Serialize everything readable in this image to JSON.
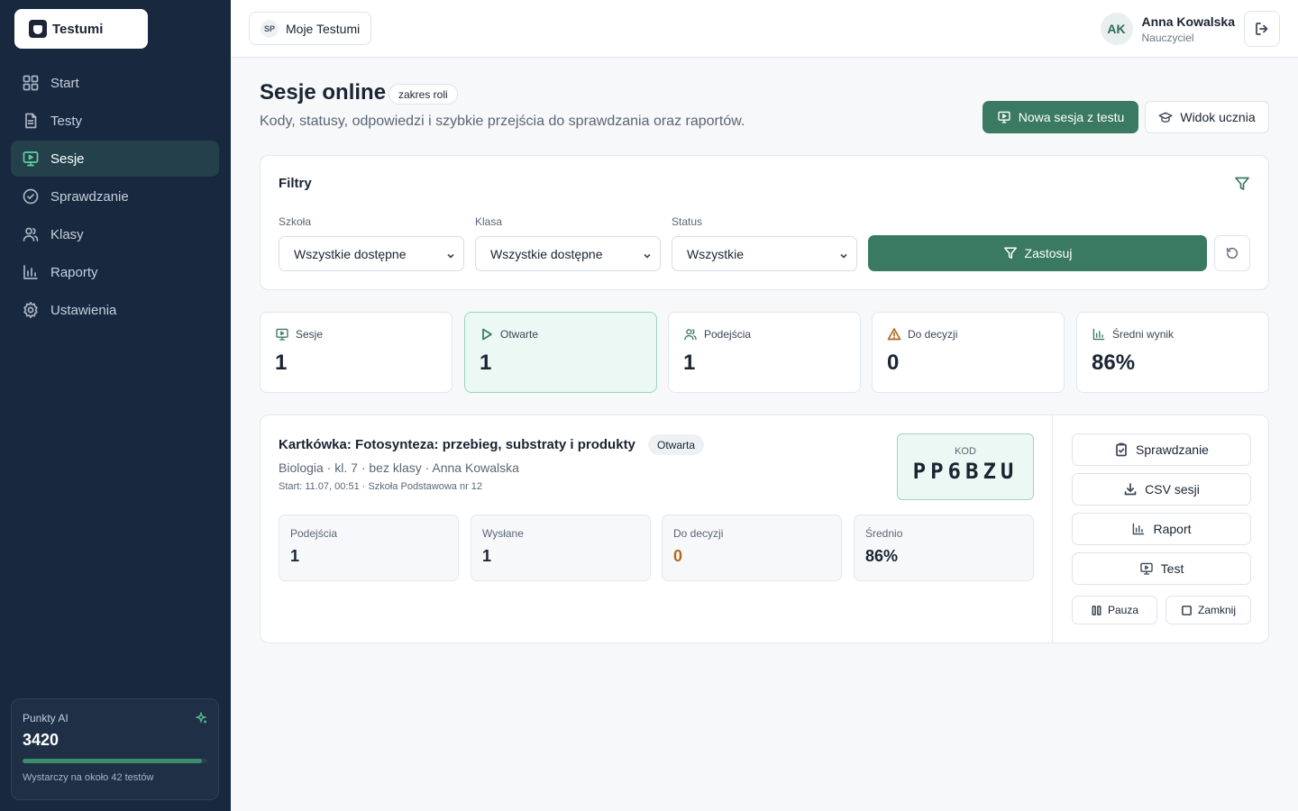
{
  "app": {
    "name": "Testumi"
  },
  "sidebar": {
    "items": [
      {
        "label": "Start",
        "icon": "grid-icon"
      },
      {
        "label": "Testy",
        "icon": "document-icon"
      },
      {
        "label": "Sesje",
        "icon": "monitor-icon",
        "active": true
      },
      {
        "label": "Sprawdzanie",
        "icon": "check-circle-icon"
      },
      {
        "label": "Klasy",
        "icon": "users-icon"
      },
      {
        "label": "Raporty",
        "icon": "bar-chart-icon"
      },
      {
        "label": "Ustawienia",
        "icon": "gear-icon"
      }
    ],
    "ai": {
      "label": "Punkty AI",
      "value": "3420",
      "progress": 0.97,
      "note": "Wystarczy na około 42 testów"
    }
  },
  "topbar": {
    "workspace_badge": "SP",
    "workspace_label": "Moje Testumi",
    "user": {
      "initials": "AK",
      "name": "Anna Kowalska",
      "role": "Nauczyciel"
    }
  },
  "page": {
    "title": "Sesje online",
    "scope_badge": "zakres roli",
    "subtitle": "Kody, statusy, odpowiedzi i szybkie przejścia do sprawdzania oraz raportów.",
    "new_session_label": "Nowa sesja z testu",
    "student_view_label": "Widok ucznia"
  },
  "filters": {
    "title": "Filtry",
    "school": {
      "label": "Szkoła",
      "value": "Wszystkie dostępne"
    },
    "class": {
      "label": "Klasa",
      "value": "Wszystkie dostępne"
    },
    "status": {
      "label": "Status",
      "value": "Wszystkie"
    },
    "apply_label": "Zastosuj"
  },
  "stats": [
    {
      "label": "Sesje",
      "value": "1"
    },
    {
      "label": "Otwarte",
      "value": "1"
    },
    {
      "label": "Podejścia",
      "value": "1"
    },
    {
      "label": "Do decyzji",
      "value": "0"
    },
    {
      "label": "Średni wynik",
      "value": "86%"
    }
  ],
  "session": {
    "title": "Kartkówka: Fotosynteza: przebieg, substraty i produkty",
    "status": "Otwarta",
    "meta": "Biologia · kl. 7 · bez klasy · Anna Kowalska",
    "start": "Start: 11.07, 00:51 · Szkoła Podstawowa nr 12",
    "code_label": "KOD",
    "code": "PP6BZU",
    "metrics": [
      {
        "label": "Podejścia",
        "value": "1"
      },
      {
        "label": "Wysłane",
        "value": "1"
      },
      {
        "label": "Do decyzji",
        "value": "0"
      },
      {
        "label": "Średnio",
        "value": "86%"
      }
    ],
    "actions": {
      "review": "Sprawdzanie",
      "csv": "CSV sesji",
      "report": "Raport",
      "test": "Test",
      "pause": "Pauza",
      "close": "Zamknij"
    }
  },
  "colors": {
    "sidebar": "#18283f",
    "accent": "#3a7a63",
    "highlight_bg": "#ecf8f3",
    "warning": "#b06a1e"
  }
}
